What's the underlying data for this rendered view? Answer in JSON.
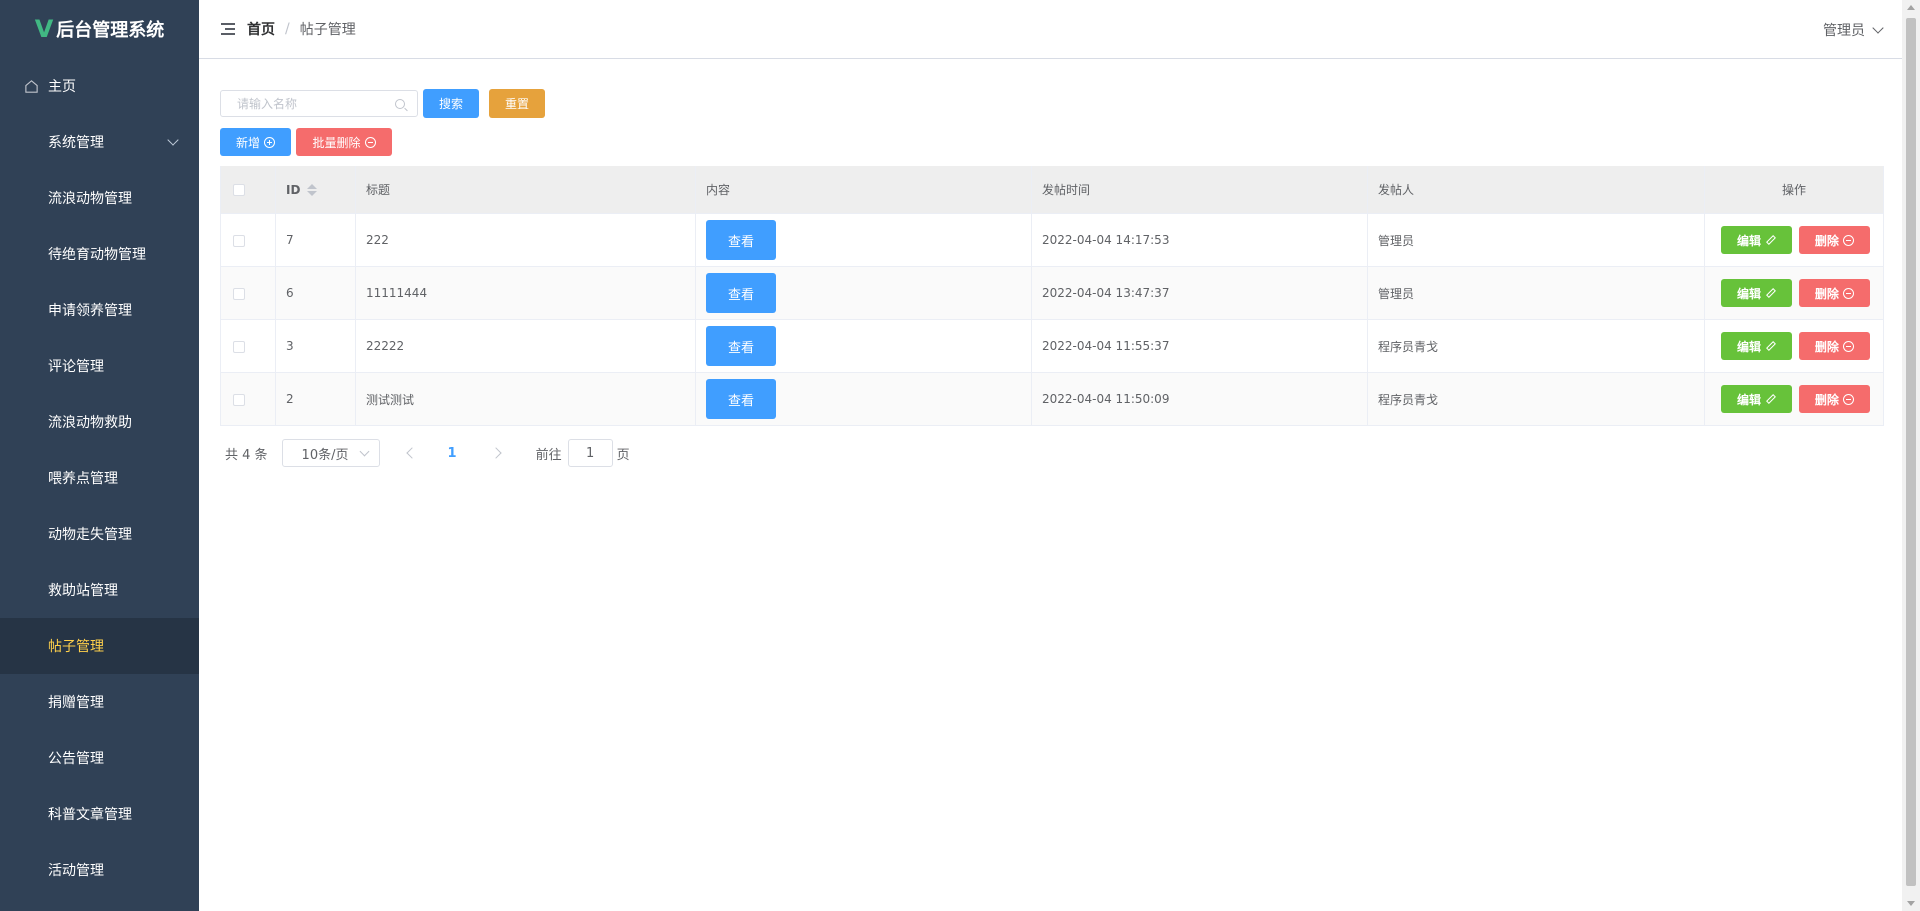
{
  "app": {
    "title": "后台管理系统"
  },
  "sidebar": {
    "items": [
      {
        "label": "主页",
        "icon": "home-icon"
      },
      {
        "label": "系统管理",
        "icon": "grid-icon",
        "expandable": true
      },
      {
        "label": "流浪动物管理",
        "icon": "grid-icon"
      },
      {
        "label": "待绝育动物管理",
        "icon": "grid-icon"
      },
      {
        "label": "申请领养管理",
        "icon": "grid-icon"
      },
      {
        "label": "评论管理",
        "icon": "grid-icon"
      },
      {
        "label": "流浪动物救助",
        "icon": "grid-icon"
      },
      {
        "label": "喂养点管理",
        "icon": "grid-icon"
      },
      {
        "label": "动物走失管理",
        "icon": "grid-icon"
      },
      {
        "label": "救助站管理",
        "icon": "grid-icon"
      },
      {
        "label": "帖子管理",
        "icon": "grid-icon",
        "active": true
      },
      {
        "label": "捐赠管理",
        "icon": "grid-icon"
      },
      {
        "label": "公告管理",
        "icon": "grid-icon"
      },
      {
        "label": "科普文章管理",
        "icon": "grid-icon"
      },
      {
        "label": "活动管理",
        "icon": "grid-icon"
      }
    ]
  },
  "header": {
    "breadcrumb": {
      "home": "首页",
      "separator": "/",
      "current": "帖子管理"
    },
    "user": "管理员"
  },
  "search": {
    "placeholder": "请输入名称",
    "value": "",
    "search_label": "搜索",
    "reset_label": "重置"
  },
  "actions": {
    "add_label": "新增",
    "batch_delete_label": "批量删除"
  },
  "table": {
    "columns": {
      "id": "ID",
      "title": "标题",
      "content": "内容",
      "time": "发帖时间",
      "author": "发帖人",
      "ops": "操作"
    },
    "view_label": "查看",
    "edit_label": "编辑",
    "delete_label": "删除",
    "rows": [
      {
        "id": "7",
        "title": "222",
        "time": "2022-04-04 14:17:53",
        "author": "管理员"
      },
      {
        "id": "6",
        "title": "11111444",
        "time": "2022-04-04 13:47:37",
        "author": "管理员"
      },
      {
        "id": "3",
        "title": "22222",
        "time": "2022-04-04 11:55:37",
        "author": "程序员青戈"
      },
      {
        "id": "2",
        "title": "测试测试",
        "time": "2022-04-04 11:50:09",
        "author": "程序员青戈"
      }
    ]
  },
  "pagination": {
    "total": "共 4 条",
    "page_size": "10条/页",
    "current_page": "1",
    "goto_label": "前往",
    "goto_value": "1",
    "goto_suffix": "页"
  },
  "colors": {
    "sidebar_bg": "#304156",
    "active_text": "#ffd04b",
    "primary": "#409eff",
    "success": "#67c23a",
    "warning": "#e6a23c",
    "danger": "#f56c6c"
  }
}
